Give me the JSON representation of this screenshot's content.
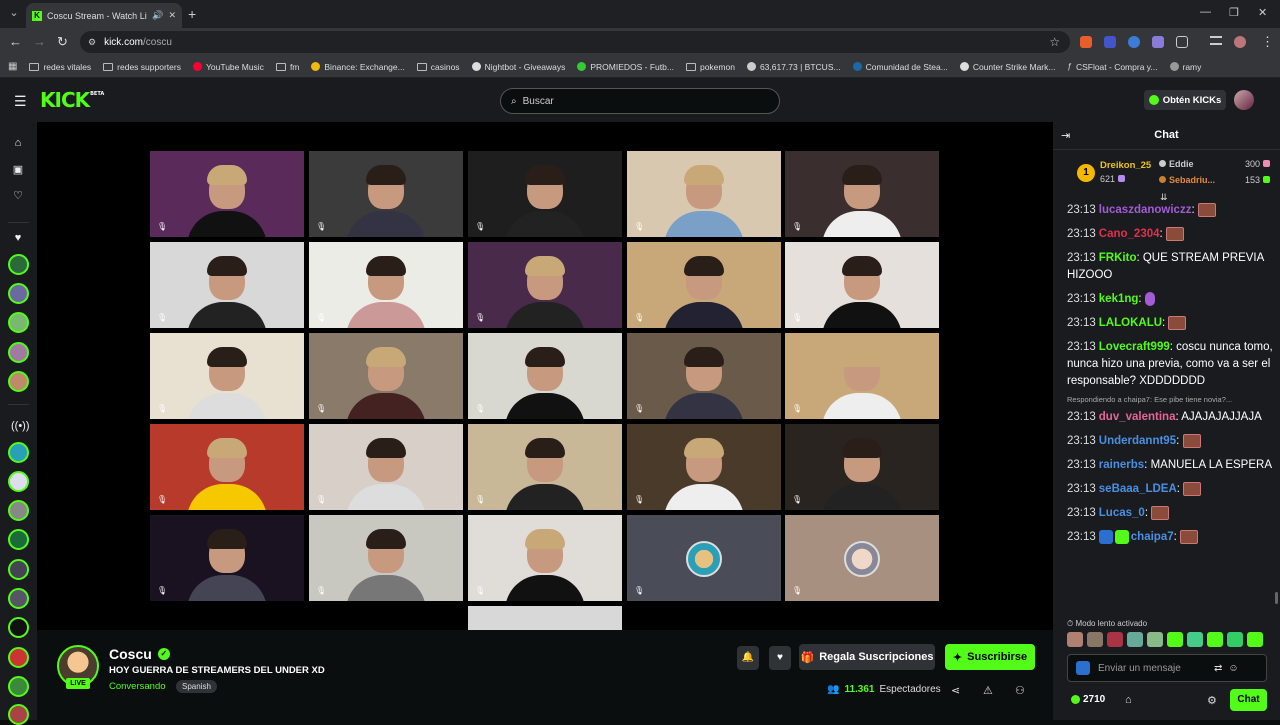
{
  "browser": {
    "tab_title": "Coscu Stream - Watch Live",
    "url_host": "kick.com",
    "url_path": "/coscu",
    "bookmarks": [
      "redes vitales",
      "redes supporters",
      "YouTube Music",
      "fm",
      "Binance: Exchange...",
      "casinos",
      "Nightbot - Giveaways",
      "PROMIEDOS - Futb...",
      "pokemon",
      "63,617.73 | BTCUS...",
      "Comunidad de Stea...",
      "Counter Strike Mark...",
      "CSFloat - Compra y...",
      "ramy"
    ]
  },
  "header": {
    "logo": "KICK",
    "logo_beta": "BETA",
    "search_placeholder": "Buscar",
    "get_kicks": "Obtén KICKs"
  },
  "stream": {
    "streamer": "Coscu",
    "live_label": "LIVE",
    "title": "HOY GUERRA DE STREAMERS DEL UNDER XD",
    "category": "Conversando",
    "language": "Spanish",
    "gift_subs": "Regala Suscripciones",
    "subscribe": "Suscribirse",
    "viewer_count": "11.361",
    "viewers_label": "Espectadores"
  },
  "chat": {
    "title": "Chat",
    "leaderboard": {
      "first_rank": "1",
      "first_name": "Dreikon_25",
      "first_value": "621",
      "second_name": "Eddie",
      "second_value": "300",
      "third_name": "Sebadriu...",
      "third_value": "153"
    },
    "messages": [
      {
        "time": "23:13",
        "user": "lucaszdanowiczz",
        "color": "#a35bd6",
        "text": "",
        "emote": "brown"
      },
      {
        "time": "23:13",
        "user": "Cano_2304",
        "color": "#e0304a",
        "text": "",
        "emote": "brown"
      },
      {
        "time": "23:13",
        "user": "FRKito",
        "color": "#53fc18",
        "text": "QUE STREAM PREVIA HIZOOO",
        "emote": ""
      },
      {
        "time": "23:13",
        "user": "kek1ng",
        "color": "#53fc18",
        "text": "",
        "emote": "purple"
      },
      {
        "time": "23:13",
        "user": "LALOKALU",
        "color": "#53fc18",
        "text": "",
        "emote": "brown"
      },
      {
        "time": "23:13",
        "user": "Lovecraft999",
        "color": "#53fc18",
        "text": "coscu nunca tomo, nunca hizo una previa, como va a ser el responsable? XDDDDDDD",
        "emote": ""
      },
      {
        "time": "23:13",
        "user": "duv_valentina",
        "color": "#e8639c",
        "text": "AJAJAJAJJAJA",
        "emote": "",
        "reply": "Respondiendo a chaipa7: Ese pibe tiene novia?..."
      },
      {
        "time": "23:13",
        "user": "Underdannt95",
        "color": "#4a90e2",
        "text": "",
        "emote": "brown"
      },
      {
        "time": "23:13",
        "user": "rainerbs",
        "color": "#4a90e2",
        "text": "MANUELA LA ESPERA",
        "emote": ""
      },
      {
        "time": "23:13",
        "user": "seBaaa_LDEA",
        "color": "#4a90e2",
        "text": "",
        "emote": "brown"
      },
      {
        "time": "23:13",
        "user": "Lucas_0",
        "color": "#4a90e2",
        "text": "",
        "emote": "brown"
      },
      {
        "time": "23:13",
        "user": "chaipa7",
        "color": "#4a90e2",
        "text": "",
        "emote": "brown",
        "badges": true
      }
    ],
    "slow_mode": "Modo lento activado",
    "input_placeholder": "Enviar un mensaje",
    "kicks_balance": "2710",
    "chat_button": "Chat"
  }
}
